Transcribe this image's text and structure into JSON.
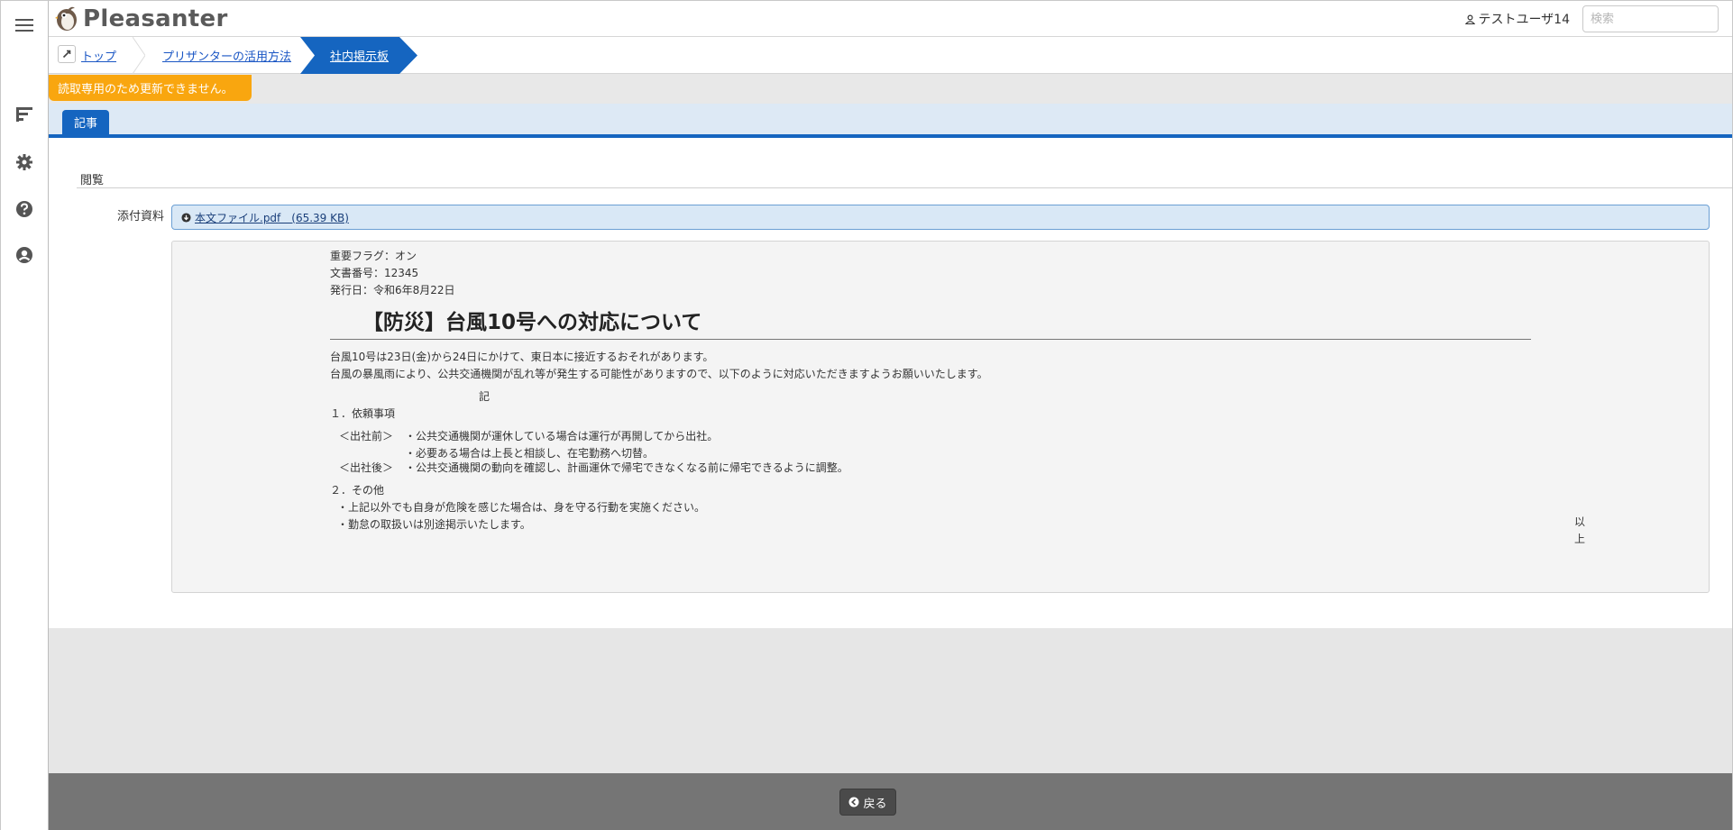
{
  "header": {
    "app_name": "Pleasanter",
    "user_name": "テストユーザ14",
    "search_placeholder": "検索"
  },
  "breadcrumb": {
    "items": [
      {
        "label": "トップ"
      },
      {
        "label": "プリザンターの活用方法"
      },
      {
        "label": "社内掲示板"
      }
    ]
  },
  "notice": "読取専用のため更新できません。",
  "tabs": [
    {
      "label": "記事"
    }
  ],
  "section": {
    "title": "閲覧",
    "attachment_label": "添付資料",
    "attachment_file": "本文ファイル.pdf　(65.39 KB)"
  },
  "document": {
    "meta": [
      "重要フラグ：オン",
      "文書番号：12345",
      "発行日：令和6年8月22日"
    ],
    "title": "【防災】台風10号への対応について",
    "intro": [
      "台風10号は23日(金)から24日にかけて、東日本に接近するおそれがあります。",
      "台風の暴風雨により、公共交通機関が乱れ等が発生する可能性がありますので、以下のように対応いただきますようお願いいたします。"
    ],
    "ki": "記",
    "item1_heading": "１．依頼事項",
    "before_label": "＜出社前＞",
    "before_line1": "・公共交通機関が運休している場合は運行が再開してから出社。",
    "before_line2": "・必要ある場合は上長と相談し、在宅勤務へ切替。",
    "after_label": "＜出社後＞",
    "after_line1": "・公共交通機関の動向を確認し、計画運休で帰宅できなくなる前に帰宅できるように調整。",
    "item2_heading": "２．その他",
    "other_line1": "・上記以外でも自身が危険を感じた場合は、身を守る行動を実施ください。",
    "other_line2": "・勤怠の取扱いは別途掲示いたします。",
    "closing": "以上"
  },
  "footer": {
    "back_label": "戻る"
  },
  "colors": {
    "accent": "#1565c0",
    "notice": "#f9a60f",
    "footer": "#757575"
  }
}
